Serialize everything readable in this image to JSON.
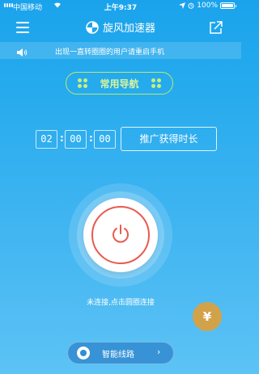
{
  "status_bar": {
    "carrier": "中国移动",
    "time": "上午9:37",
    "battery": "100%"
  },
  "header": {
    "title": "旋风加速器"
  },
  "notice": {
    "text": "出现一直转圈圈的用户请重启手机"
  },
  "nav": {
    "label": "常用导航"
  },
  "timer": {
    "hours": "02",
    "minutes": "00",
    "seconds": "00",
    "separator": ":",
    "promote_label": "推广获得时长"
  },
  "connection": {
    "status_text": "未连接,点击圆圈连接"
  },
  "recharge": {
    "symbol": "¥"
  },
  "route": {
    "label": "智能线路",
    "chevron": "›"
  },
  "colors": {
    "background_top": "#1aa3ec",
    "background_bottom": "#5cc3f5",
    "nav_accent": "#c6f07d",
    "power_ring": "#e85a4f",
    "recharge": "#d2a24a"
  },
  "icons": {
    "menu": "menu-icon",
    "brand": "logo-icon",
    "share": "share-icon",
    "speaker": "speaker-icon",
    "nav_left": "dots-icon",
    "nav_right": "dots-icon",
    "power": "power-icon",
    "route": "route-icon"
  }
}
